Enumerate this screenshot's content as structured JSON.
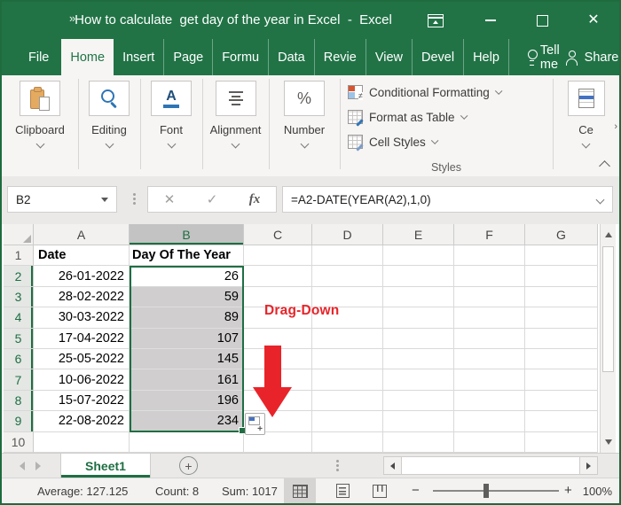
{
  "window": {
    "title": "How to calculate  get day of the year in Excel  -  Excel"
  },
  "menu": {
    "tabs": [
      {
        "label": "File"
      },
      {
        "label": "Home"
      },
      {
        "label": "Insert"
      },
      {
        "label": "Page"
      },
      {
        "label": "Formu"
      },
      {
        "label": "Data"
      },
      {
        "label": "Revie"
      },
      {
        "label": "View"
      },
      {
        "label": "Devel"
      },
      {
        "label": "Help"
      }
    ],
    "active_tab": "Home",
    "tell_me_label": "Tell me",
    "share_label": "Share"
  },
  "ribbon": {
    "groups": [
      {
        "label": "Clipboard"
      },
      {
        "label": "Editing"
      },
      {
        "label": "Font"
      },
      {
        "label": "Alignment"
      },
      {
        "label": "Number"
      }
    ],
    "styles": {
      "caption": "Styles",
      "items": [
        {
          "label": "Conditional Formatting"
        },
        {
          "label": "Format as Table"
        },
        {
          "label": "Cell Styles"
        }
      ]
    },
    "cells": {
      "label_truncated": "Ce"
    }
  },
  "formula_bar": {
    "name_box_value": "B2",
    "formula": "=A2-DATE(YEAR(A2),1,0)"
  },
  "sheet": {
    "column_headers": [
      "A",
      "B",
      "C",
      "D",
      "E",
      "F",
      "G"
    ],
    "selected_column": "B",
    "selection_range": "B2:B9",
    "rows": [
      {
        "n": "1",
        "a": "Date",
        "b": "Day Of The Year"
      },
      {
        "n": "2",
        "a": "26-01-2022",
        "b": "26"
      },
      {
        "n": "3",
        "a": "28-02-2022",
        "b": "59"
      },
      {
        "n": "4",
        "a": "30-03-2022",
        "b": "89"
      },
      {
        "n": "5",
        "a": "17-04-2022",
        "b": "107"
      },
      {
        "n": "6",
        "a": "25-05-2022",
        "b": "145"
      },
      {
        "n": "7",
        "a": "10-06-2022",
        "b": "161"
      },
      {
        "n": "8",
        "a": "15-07-2022",
        "b": "196"
      },
      {
        "n": "9",
        "a": "22-08-2022",
        "b": "234"
      },
      {
        "n": "10",
        "a": "",
        "b": ""
      }
    ]
  },
  "annotation": {
    "label": "Drag-Down",
    "color": "#e8242a"
  },
  "sheet_tabs": {
    "active": "Sheet1"
  },
  "status_bar": {
    "average_label": "Average: 127.125",
    "count_label": "Count: 8",
    "sum_label": "Sum: 1017",
    "zoom_label": "100%"
  },
  "icons": {
    "pin": "»",
    "close": "✕",
    "font_letter": "A",
    "percent": "%",
    "not_equal": "≠",
    "cancel": "✕",
    "enter": "✓",
    "fx": "fx",
    "cells_scroll": "›",
    "add_sheet": "+",
    "autofill_plus": "+",
    "zoom_out": "−",
    "zoom_in": "+"
  },
  "colors": {
    "accent_green": "#217346",
    "selection_fill": "#d0cece",
    "annotation_red": "#e8242a"
  }
}
